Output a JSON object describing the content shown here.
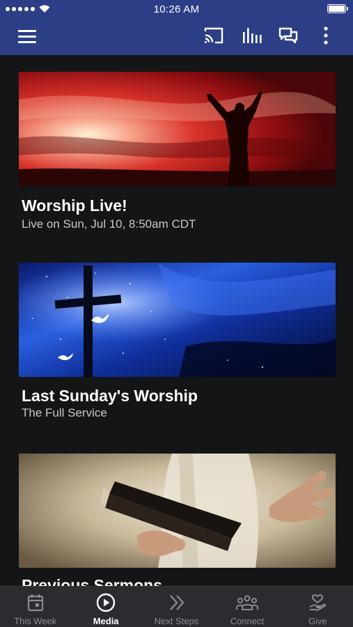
{
  "status_bar": {
    "time": "10:26 AM"
  },
  "app_bar": {
    "icons": [
      "menu-icon",
      "cast-icon",
      "audio-bars-icon",
      "chat-icon",
      "more-vertical-icon"
    ]
  },
  "media_items": [
    {
      "title": "Worship Live!",
      "subtitle": "Live on Sun, Jul 10, 8:50am CDT"
    },
    {
      "title": "Last Sunday's Worship",
      "subtitle": "The Full Service"
    },
    {
      "title": "Previous Sermons",
      "subtitle": ""
    }
  ],
  "tab_bar": {
    "tabs": [
      {
        "label": "This Week",
        "icon": "calendar-icon",
        "active": false
      },
      {
        "label": "Media",
        "icon": "play-circle-icon",
        "active": true
      },
      {
        "label": "Next Steps",
        "icon": "double-chevron-right-icon",
        "active": false
      },
      {
        "label": "Connect",
        "icon": "people-icon",
        "active": false
      },
      {
        "label": "Give",
        "icon": "heart-hand-icon",
        "active": false
      }
    ]
  },
  "colors": {
    "header": "#2c3e86",
    "background": "#141517",
    "tab_bar": "#2b2c30",
    "inactive_tab": "#8b8c91"
  }
}
